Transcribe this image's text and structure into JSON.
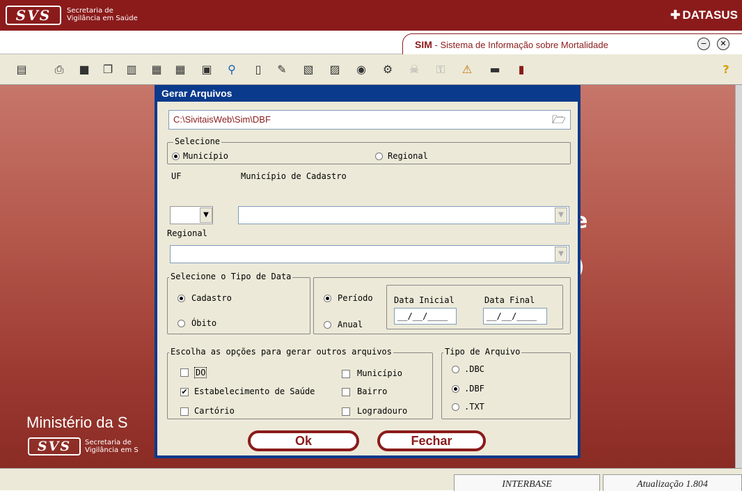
{
  "brand": {
    "logo": "SVS",
    "subtitle_line1": "Secretaria de",
    "subtitle_line2": "Vigilância em Saúde",
    "datasus": "DATASUS"
  },
  "app": {
    "acronym": "SIM",
    "separator": "-",
    "title": "Sistema de Informação sobre Mortalidade",
    "minimize_icon": "minus-circle-icon",
    "close_icon": "x-circle-icon"
  },
  "toolbar": {
    "icons": [
      "file-export-icon",
      "print-icon",
      "save-icon",
      "copy-icon",
      "paste-icon",
      "export-icon",
      "calendar-icon",
      "form-icon",
      "search-icon",
      "document-icon",
      "edit-icon",
      "import-icon",
      "report-icon",
      "cd-icon",
      "network-icon",
      "skull-icon",
      "lock-icon",
      "warning-icon",
      "keyboard-icon",
      "exit-door-icon",
      "help-icon"
    ],
    "help_label": "?"
  },
  "background": {
    "ministerio": "Ministério da S",
    "logo": "SVS",
    "sub1": "Secretaria de",
    "sub2": "Vigilância em S"
  },
  "dialog": {
    "title": "Gerar Arquivos",
    "path": "C:\\SivitaisWeb\\Sim\\DBF",
    "selecione_legend": "Selecione",
    "opt_municipio": "Município",
    "opt_regional": "Regional",
    "uf_label": "UF",
    "municipio_cadastro_label": "Município de Cadastro",
    "regional_label": "Regional",
    "tipo_data_legend": "Selecione o Tipo de Data",
    "opt_cadastro": "Cadastro",
    "opt_obito": "Óbito",
    "opt_periodo": "Período",
    "opt_anual": "Anual",
    "data_inicial_label": "Data Inicial",
    "data_final_label": "Data Final",
    "data_inicial_value": "__/__/____",
    "data_final_value": "__/__/____",
    "outros_legend": "Escolha as opções para gerar outros arquivos",
    "chk_do": "DO",
    "chk_estabelecimento": "Estabelecimento de Saúde",
    "chk_cartorio": "Cartório",
    "chk_municipio": "Município",
    "chk_bairro": "Bairro",
    "chk_logradouro": "Logradouro",
    "tipo_arquivo_legend": "Tipo de Arquivo",
    "opt_dbc": ".DBC",
    "opt_dbf": ".DBF",
    "opt_txt": ".TXT",
    "ok_label": "Ok",
    "fechar_label": "Fechar",
    "checkmark": "✔"
  },
  "status": {
    "db": "INTERBASE",
    "version": "Atualização 1.804"
  }
}
